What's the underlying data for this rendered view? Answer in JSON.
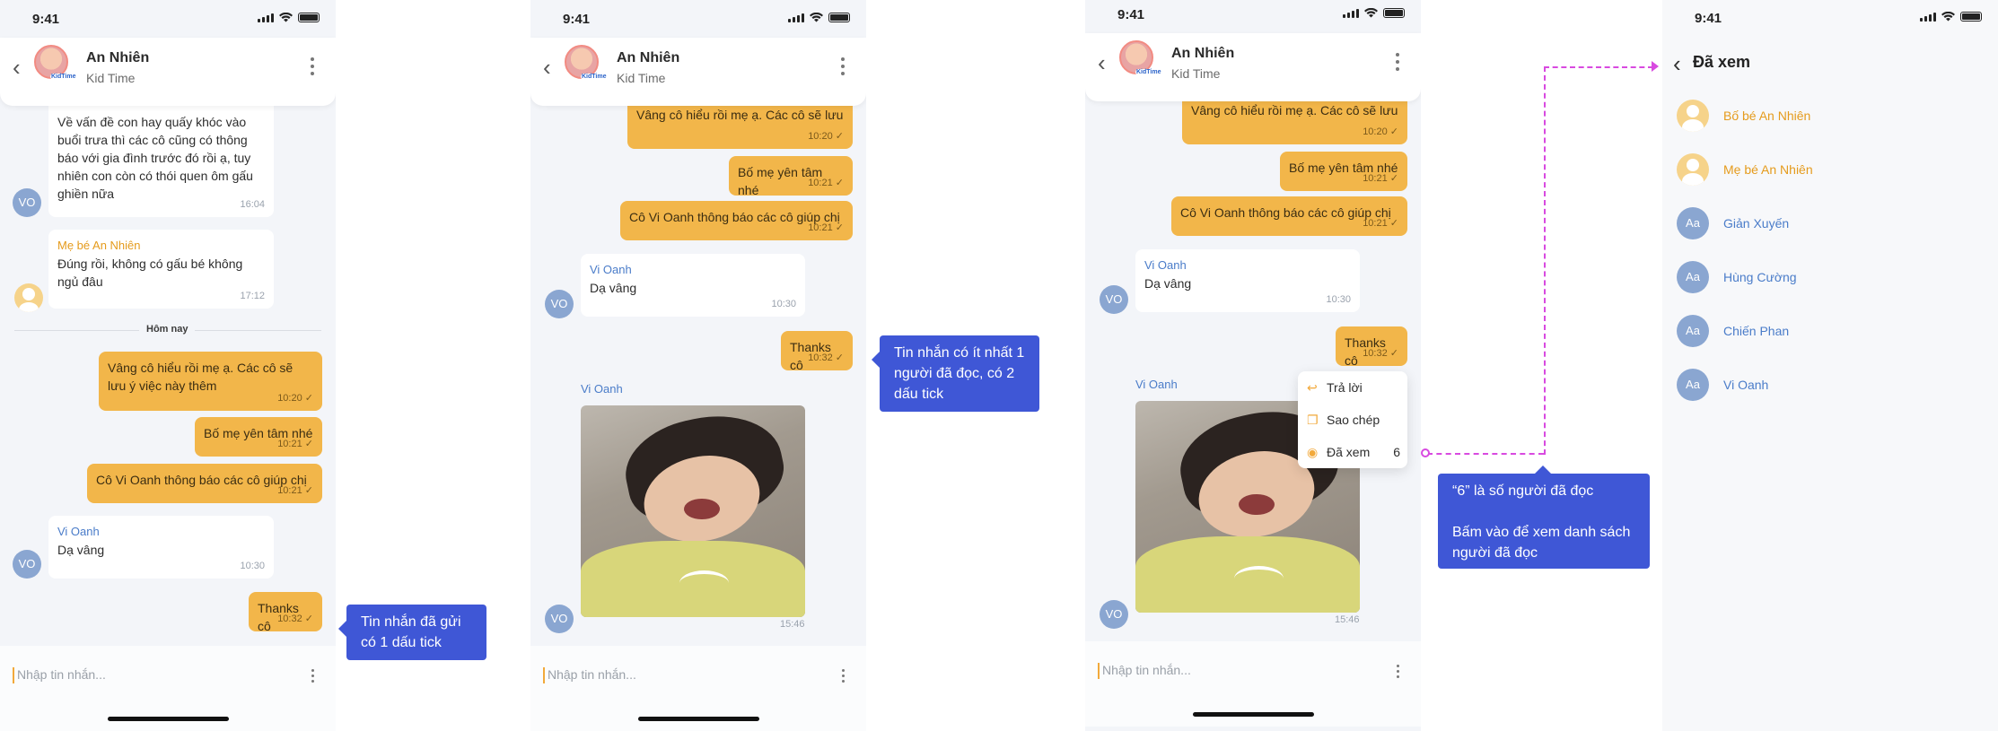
{
  "status": {
    "time": "9:41"
  },
  "chat": {
    "name": "An Nhiên",
    "subtitle": "Kid Time",
    "badge": "KidTime"
  },
  "screen1": {
    "msg1": {
      "text": "Về vấn đề con hay quấy khóc vào buổi trưa thì các cô cũng có thông báo với gia đình trước đó rồi ạ, tuy nhiên con còn có thói quen ôm gấu ghiền nữa",
      "time": "16:04",
      "avatar": "VO"
    },
    "msg2": {
      "sender": "Mẹ bé An Nhiên",
      "text": "Đúng rồi, không có gấu bé không ngủ đâu",
      "time": "17:12"
    },
    "divider": "Hôm nay",
    "out1": {
      "text": "Vâng cô hiểu rồi mẹ ạ. Các cô sẽ lưu ý việc này thêm",
      "time": "10:20"
    },
    "out2": {
      "text": "Bố mẹ yên tâm nhé",
      "time": "10:21"
    },
    "out3": {
      "text": "Cô Vi Oanh thông báo các cô giúp chị",
      "time": "10:21"
    },
    "msg3": {
      "sender": "Vi Oanh",
      "text": "Dạ vâng",
      "time": "10:30",
      "avatar": "VO"
    },
    "out4": {
      "text": "Thanks cô",
      "time": "10:32"
    }
  },
  "screen2": {
    "out0": {
      "text": "Vâng cô hiểu rồi mẹ ạ. Các cô sẽ lưu ý việc này thêm",
      "time": "10:20"
    },
    "out2": {
      "text": "Bố mẹ yên tâm nhé",
      "time": "10:21"
    },
    "out3": {
      "text": "Cô Vi Oanh thông báo các cô giúp chị",
      "time": "10:21"
    },
    "msg3": {
      "sender": "Vi Oanh",
      "text": "Dạ vâng",
      "time": "10:30",
      "avatar": "VO"
    },
    "out4": {
      "text": "Thanks cô",
      "time": "10:32"
    },
    "photo": {
      "sender": "Vi Oanh",
      "time": "15:46",
      "avatar": "VO"
    }
  },
  "composer": {
    "placeholder": "Nhập tin nhắn..."
  },
  "tips": {
    "tip1": "Tin nhắn đã gửi có 1 dấu tick",
    "tip2": "Tin nhắn có ít nhất 1 người đã đọc, có 2 dấu tick",
    "tip3a": "“6” là số người đã đọc",
    "tip3b": "Bấm vào để xem danh sách người đã đọc"
  },
  "context_menu": {
    "reply": "Trả lời",
    "copy": "Sao chép",
    "seen": "Đã xem",
    "seen_count": "6"
  },
  "seen_list": {
    "title": "Đã xem",
    "items": [
      {
        "name": "Bố bé An Nhiên",
        "avatar": "",
        "color": "gold"
      },
      {
        "name": "Mẹ bé An Nhiên",
        "avatar": "",
        "color": "gold"
      },
      {
        "name": "Giản Xuyến",
        "avatar": "Aa",
        "color": "blue"
      },
      {
        "name": "Hùng Cường",
        "avatar": "Aa",
        "color": "blue"
      },
      {
        "name": "Chiến Phan",
        "avatar": "Aa",
        "color": "blue"
      },
      {
        "name": "Vi Oanh",
        "avatar": "Aa",
        "color": "blue"
      }
    ]
  },
  "colors": {
    "accent": "#f2b64a",
    "tooltip": "#3f57d6",
    "dash": "#d84ae0"
  }
}
